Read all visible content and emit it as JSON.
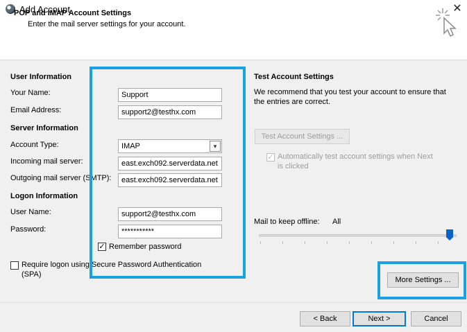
{
  "window": {
    "title": "Add Account",
    "close_glyph": "✕"
  },
  "header": {
    "title": "POP and IMAP Account Settings",
    "subtitle": "Enter the mail server settings for your account."
  },
  "user_info": {
    "section": "User Information",
    "name_label": "Your Name:",
    "name_value": "Support",
    "email_label": "Email Address:",
    "email_value": "support2@testhx.com"
  },
  "server_info": {
    "section": "Server Information",
    "account_type_label": "Account Type:",
    "account_type_value": "IMAP",
    "incoming_label": "Incoming mail server:",
    "incoming_value": "east.exch092.serverdata.net",
    "outgoing_label": "Outgoing mail server (SMTP):",
    "outgoing_value": "east.exch092.serverdata.net"
  },
  "logon_info": {
    "section": "Logon Information",
    "username_label": "User Name:",
    "username_value": "support2@testhx.com",
    "password_label": "Password:",
    "password_value": "***********",
    "remember_label": "Remember password",
    "remember_checked": true,
    "spa_label_line1": "Require logon using Secure Password Authentication",
    "spa_label_line2": "(SPA)",
    "spa_checked": false
  },
  "test_settings": {
    "section": "Test Account Settings",
    "description_line1": "We recommend that you test your account to ensure that",
    "description_line2": "the entries are correct.",
    "test_button": "Test Account Settings ...",
    "auto_test_line1": "Automatically test account settings when Next",
    "auto_test_line2": "is clicked",
    "auto_test_checked": true
  },
  "offline": {
    "label": "Mail to keep offline:",
    "value": "All",
    "level": 1.0
  },
  "buttons": {
    "more_settings": "More Settings ...",
    "back": "< Back",
    "next": "Next >",
    "cancel": "Cancel"
  },
  "colors": {
    "highlight": "#1ba1e2",
    "slider_thumb": "#0a64c8",
    "primary_border": "#0078d7"
  },
  "icons": {
    "app": "outlook-globe-icon",
    "wizard": "cursor-sparkle-icon"
  }
}
